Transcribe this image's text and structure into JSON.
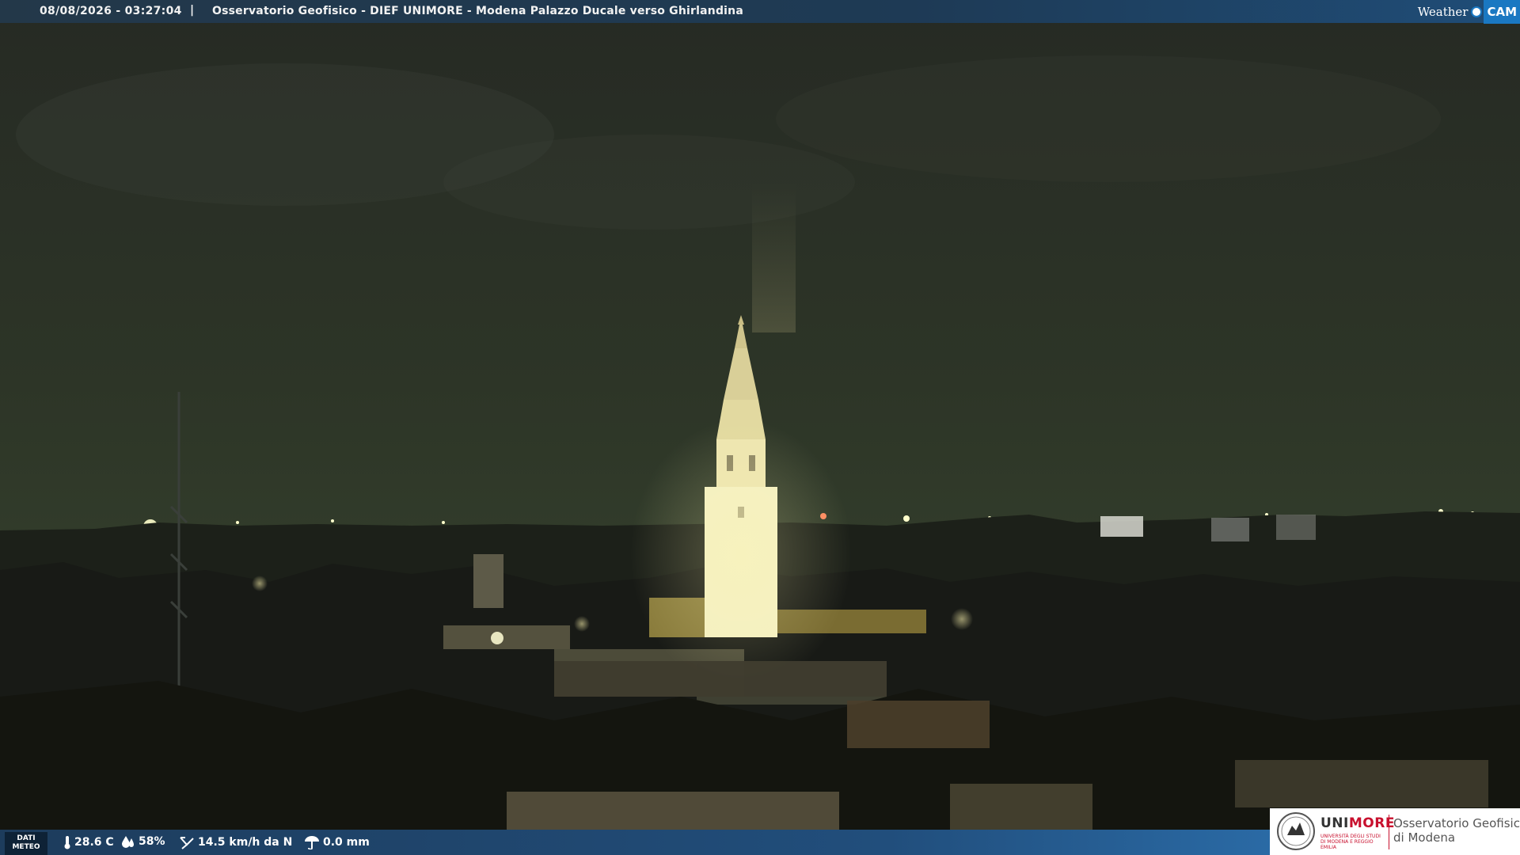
{
  "header": {
    "timestamp": "08/08/2026 - 03:27:04",
    "separator": "|",
    "title": "Osservatorio Geofisico - DIEF UNIMORE - Modena Palazzo Ducale verso Ghirlandina",
    "brand_weather": "Weather",
    "brand_cam": "CAM"
  },
  "weather": {
    "label_line1": "DATI",
    "label_line2": "METEO",
    "temperature": "28.6 C",
    "humidity": "58%",
    "wind": "14.5 km/h da N",
    "rain": "0.0 mm",
    "icons": [
      "thermometer-icon",
      "humidity-drop-icon",
      "wind-icon",
      "rain-gauge-icon"
    ]
  },
  "logo": {
    "uni_prefix": "UNI",
    "uni_suffix": "MORE",
    "uni_sub": "UNIVERSITÀ DEGLI STUDI DI MODENA E REGGIO EMILIA",
    "observatory_line1": "Osservatorio Geofisico",
    "observatory_line2": "di Modena"
  },
  "colors": {
    "sky": "#2a3226",
    "tower": "#f3eeb8",
    "header_bar": "#1e3a55",
    "accent_blue": "#1a78c2",
    "unimore_red": "#c8102e"
  }
}
